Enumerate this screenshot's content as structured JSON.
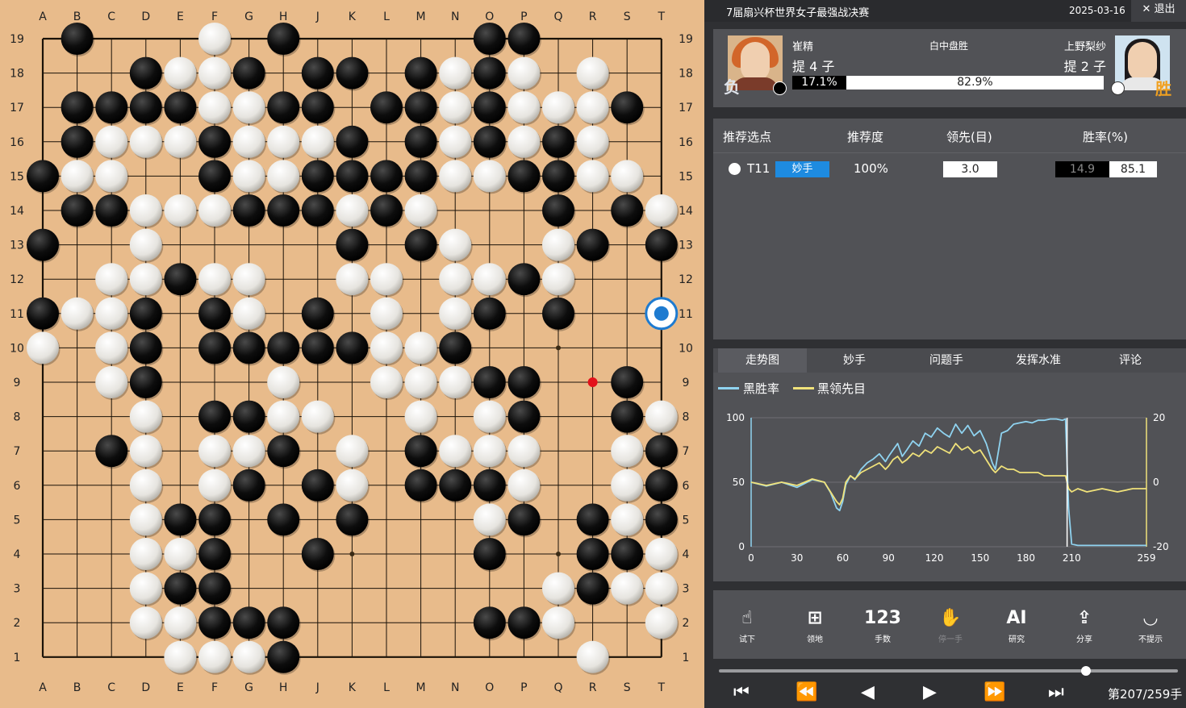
{
  "board": {
    "size": 19,
    "columns": [
      "A",
      "B",
      "C",
      "D",
      "E",
      "F",
      "G",
      "H",
      "J",
      "K",
      "L",
      "M",
      "N",
      "O",
      "P",
      "Q",
      "R",
      "S",
      "T"
    ],
    "rows": [
      "19",
      "18",
      "17",
      "16",
      "15",
      "14",
      "13",
      "12",
      "11",
      "10",
      "9",
      "8",
      "7",
      "6",
      "5",
      "4",
      "3",
      "2",
      "1"
    ],
    "grid": [
      ".B...W.B.....BB....",
      "...BWWB.BB.BWBW.W..",
      ".BBBBWWBB.BBWBWWWB.",
      ".BWWWBWWWB.BWBWBW..",
      "BWW..BWWBBBBWWBBWW.",
      ".BBWWWBBBWBW...B.BW",
      "B..W.....B.BW..WB.BB",
      "..WWBWW..WW.WWBW...",
      "BWWB.BW.B.W.WB.B...",
      "W.WB.BBBBBWWB......",
      "..WB...W..WWWBB..B.",
      "...W.BBWW..W.WB..BW",
      "..BW.WWB.W.BWWW..WB",
      "...W.WB.BW.BBBW..WB",
      "...WBB.B.B...WB.BWB",
      "...WWB..B....B..BBW",
      "...WBB.........WBWW",
      "...WWBBB.....BBW..W",
      "....WWWB........W.."
    ],
    "last_move": "R9",
    "suggest": "T11"
  },
  "header": {
    "title": "7届扇兴杯世界女子最强战决赛",
    "date": "2025-03-16",
    "exit": "退出",
    "exit_icon": "close-icon"
  },
  "players": {
    "black": {
      "name": "崔精",
      "captures": "提 4 子",
      "result": "负",
      "winrate": "17.1%"
    },
    "white": {
      "name": "上野梨纱",
      "captures": "提 2 子",
      "result": "胜",
      "winrate": "82.9%"
    },
    "result_text": "白中盘胜"
  },
  "recommend": {
    "headers": [
      "推荐选点",
      "推荐度",
      "领先(目)",
      "胜率(%)"
    ],
    "rows": [
      {
        "move": "T11",
        "badge": "妙手",
        "score": "100%",
        "lead": "3.0",
        "win_b": "14.9",
        "win_w": "85.1"
      }
    ]
  },
  "tabs": [
    "走势图",
    "妙手",
    "问题手",
    "发挥水准",
    "评论"
  ],
  "active_tab": "走势图",
  "chart_data": {
    "type": "line",
    "x_ticks": [
      "0",
      "30",
      "60",
      "90",
      "120",
      "150",
      "180",
      "210",
      "259"
    ],
    "y_left_ticks": [
      "100",
      "50",
      "0"
    ],
    "y_right_ticks": [
      "20",
      "0",
      "-20"
    ],
    "xlim": [
      0,
      259
    ],
    "ylim_left": [
      0,
      100
    ],
    "ylim_right": [
      -20,
      20
    ],
    "series": [
      {
        "name": "黑胜率",
        "axis": "left",
        "color": "#8fd3f0",
        "x": [
          0,
          10,
          20,
          30,
          40,
          48,
          52,
          56,
          58,
          60,
          62,
          65,
          68,
          72,
          76,
          80,
          84,
          88,
          90,
          93,
          96,
          99,
          102,
          106,
          110,
          114,
          118,
          122,
          126,
          130,
          134,
          138,
          142,
          146,
          150,
          154,
          158,
          160,
          164,
          168,
          172,
          176,
          180,
          184,
          188,
          192,
          196,
          200,
          204,
          206,
          208,
          210,
          214,
          220,
          230,
          240,
          250,
          259
        ],
        "y": [
          50,
          47,
          50,
          46,
          52,
          50,
          42,
          30,
          28,
          35,
          48,
          55,
          52,
          60,
          65,
          68,
          72,
          66,
          70,
          75,
          80,
          70,
          75,
          82,
          78,
          88,
          85,
          92,
          88,
          85,
          95,
          88,
          94,
          86,
          90,
          80,
          65,
          60,
          88,
          90,
          95,
          96,
          97,
          96,
          98,
          98,
          99,
          99,
          98,
          99,
          30,
          2,
          1,
          1,
          1,
          1,
          1,
          1
        ]
      },
      {
        "name": "黑领先目",
        "axis": "right",
        "color": "#f0e27a",
        "x": [
          0,
          10,
          20,
          30,
          40,
          48,
          52,
          56,
          58,
          60,
          62,
          65,
          68,
          72,
          76,
          80,
          84,
          88,
          90,
          93,
          96,
          99,
          102,
          106,
          110,
          114,
          118,
          122,
          126,
          130,
          134,
          138,
          142,
          146,
          150,
          154,
          158,
          160,
          164,
          168,
          172,
          176,
          180,
          184,
          188,
          192,
          196,
          200,
          204,
          206,
          208,
          210,
          214,
          220,
          230,
          240,
          250,
          259
        ],
        "y": [
          0,
          -1,
          0,
          -1,
          1,
          0,
          -3,
          -6,
          -7,
          -5,
          0,
          2,
          1,
          3,
          4,
          5,
          6,
          4,
          5,
          7,
          8,
          6,
          7,
          9,
          8,
          10,
          9,
          11,
          10,
          9,
          12,
          10,
          11,
          9,
          10,
          7,
          4,
          3,
          5,
          4,
          4,
          3,
          3,
          3,
          3,
          2,
          2,
          2,
          2,
          2,
          -2,
          -3,
          -2,
          -3,
          -2,
          -3,
          -2,
          -2
        ]
      }
    ]
  },
  "toolbar": [
    {
      "label": "试下",
      "icon": "touch-icon",
      "glyph": "☝"
    },
    {
      "label": "领地",
      "icon": "territory-icon",
      "glyph": "⊞"
    },
    {
      "label": "手数",
      "icon": "move-number-icon",
      "glyph": "123"
    },
    {
      "label": "停一手",
      "icon": "pass-hand-icon",
      "glyph": "✋"
    },
    {
      "label": "研究",
      "icon": "ai-icon",
      "glyph": "AI"
    },
    {
      "label": "分享",
      "icon": "share-icon",
      "glyph": "⇪"
    },
    {
      "label": "不提示",
      "icon": "hide-hint-icon",
      "glyph": "◡"
    }
  ],
  "playback": {
    "position_fraction": 0.8,
    "counter": "第207/259手"
  },
  "colors": {
    "board": "#e8bb8b",
    "panel": "#515256",
    "accent": "#1e8be0",
    "last_move": "#e3121b"
  }
}
